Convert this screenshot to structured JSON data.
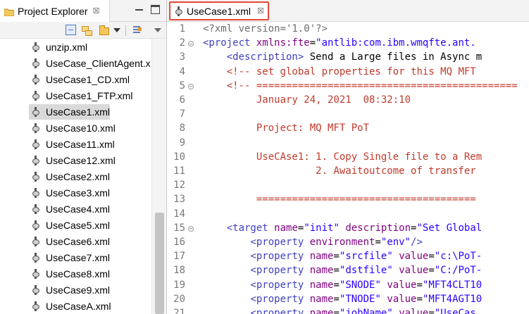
{
  "explorer": {
    "tab_label": "Project Explorer",
    "tab_close": "☒",
    "files": [
      "unzip.xml",
      "UseCase_ClientAgent.x",
      "UseCase1_CD.xml",
      "UseCase1_FTP.xml",
      "UseCase1.xml",
      "UseCase10.xml",
      "UseCase11.xml",
      "UseCase12.xml",
      "UseCase2.xml",
      "UseCase3.xml",
      "UseCase4.xml",
      "UseCase5.xml",
      "UseCase6.xml",
      "UseCase7.xml",
      "UseCase8.xml",
      "UseCase9.xml",
      "UseCaseA.xml"
    ],
    "selected_file": "UseCase1.xml"
  },
  "editor": {
    "tab_label": "UseCase1.xml",
    "tab_close": "☒",
    "lines": [
      {
        "n": "1",
        "fold": false,
        "segs": [
          [
            "decl",
            "<?xml version='1.0'?>"
          ]
        ]
      },
      {
        "n": "2",
        "fold": true,
        "segs": [
          [
            "tag",
            "<project "
          ],
          [
            "attr",
            "xmlns:fte"
          ],
          [
            "plain",
            "="
          ],
          [
            "val",
            "\"antlib:com.ibm.wmqfte.ant."
          ]
        ]
      },
      {
        "n": "3",
        "fold": false,
        "segs": [
          [
            "plain",
            "    "
          ],
          [
            "tag",
            "<description>"
          ],
          [
            "plain",
            " Send a Large files in Async m"
          ]
        ]
      },
      {
        "n": "4",
        "fold": false,
        "segs": [
          [
            "plain",
            "    "
          ],
          [
            "cmt",
            "<!-- set global properties for this MQ MFT"
          ]
        ]
      },
      {
        "n": "5",
        "fold": true,
        "segs": [
          [
            "plain",
            "    "
          ],
          [
            "cmt",
            "<!-- ============================================"
          ]
        ]
      },
      {
        "n": "6",
        "fold": false,
        "segs": [
          [
            "cmt",
            "         January 24, 2021  08:32:10"
          ]
        ]
      },
      {
        "n": "7",
        "fold": false,
        "segs": []
      },
      {
        "n": "8",
        "fold": false,
        "segs": [
          [
            "cmt",
            "         Project: MQ MFT PoT"
          ]
        ]
      },
      {
        "n": "9",
        "fold": false,
        "segs": []
      },
      {
        "n": "10",
        "fold": false,
        "segs": [
          [
            "cmt",
            "         UseCAse1: 1. Copy Single file to a Rem"
          ]
        ]
      },
      {
        "n": "11",
        "fold": false,
        "segs": [
          [
            "cmt",
            "                   2. Awaitoutcome of transfer"
          ]
        ]
      },
      {
        "n": "12",
        "fold": false,
        "segs": []
      },
      {
        "n": "13",
        "fold": false,
        "segs": [
          [
            "cmt",
            "         ====================================="
          ]
        ]
      },
      {
        "n": "14",
        "fold": false,
        "segs": []
      },
      {
        "n": "15",
        "fold": true,
        "segs": [
          [
            "plain",
            "    "
          ],
          [
            "tag",
            "<target "
          ],
          [
            "attr",
            "name"
          ],
          [
            "plain",
            "="
          ],
          [
            "val",
            "\"init\""
          ],
          [
            "plain",
            " "
          ],
          [
            "attr",
            "description"
          ],
          [
            "plain",
            "="
          ],
          [
            "val",
            "\"Set Global"
          ]
        ]
      },
      {
        "n": "16",
        "fold": false,
        "segs": [
          [
            "plain",
            "        "
          ],
          [
            "tag",
            "<property "
          ],
          [
            "attr",
            "environment"
          ],
          [
            "plain",
            "="
          ],
          [
            "val",
            "\"env\""
          ],
          [
            "tag",
            "/>"
          ]
        ]
      },
      {
        "n": "17",
        "fold": false,
        "segs": [
          [
            "plain",
            "        "
          ],
          [
            "tag",
            "<property "
          ],
          [
            "attr",
            "name"
          ],
          [
            "plain",
            "="
          ],
          [
            "val",
            "\"srcfile\""
          ],
          [
            "plain",
            " "
          ],
          [
            "attr",
            "value"
          ],
          [
            "plain",
            "="
          ],
          [
            "val",
            "\"c:\\PoT-"
          ]
        ]
      },
      {
        "n": "18",
        "fold": false,
        "segs": [
          [
            "plain",
            "        "
          ],
          [
            "tag",
            "<property "
          ],
          [
            "attr",
            "name"
          ],
          [
            "plain",
            "="
          ],
          [
            "val",
            "\"dstfile\""
          ],
          [
            "plain",
            " "
          ],
          [
            "attr",
            "value"
          ],
          [
            "plain",
            "="
          ],
          [
            "val",
            "\"C:/PoT-"
          ]
        ]
      },
      {
        "n": "19",
        "fold": false,
        "segs": [
          [
            "plain",
            "        "
          ],
          [
            "tag",
            "<property "
          ],
          [
            "attr",
            "name"
          ],
          [
            "plain",
            "="
          ],
          [
            "val",
            "\"SNODE\""
          ],
          [
            "plain",
            " "
          ],
          [
            "attr",
            "value"
          ],
          [
            "plain",
            "="
          ],
          [
            "val",
            "\"MFT4CLT10"
          ]
        ]
      },
      {
        "n": "20",
        "fold": false,
        "segs": [
          [
            "plain",
            "        "
          ],
          [
            "tag",
            "<property "
          ],
          [
            "attr",
            "name"
          ],
          [
            "plain",
            "="
          ],
          [
            "val",
            "\"TNODE\""
          ],
          [
            "plain",
            " "
          ],
          [
            "attr",
            "value"
          ],
          [
            "plain",
            "="
          ],
          [
            "val",
            "\"MFT4AGT10"
          ]
        ]
      },
      {
        "n": "21",
        "fold": false,
        "segs": [
          [
            "plain",
            "        "
          ],
          [
            "tag",
            "<property "
          ],
          [
            "attr",
            "name"
          ],
          [
            "plain",
            "="
          ],
          [
            "val",
            "\"jobName\""
          ],
          [
            "plain",
            " "
          ],
          [
            "attr",
            "value"
          ],
          [
            "plain",
            "="
          ],
          [
            "val",
            "\"UseCas"
          ]
        ]
      }
    ]
  },
  "colors": {
    "tab_highlight": "#e8483b",
    "selection": "#d9d9d9",
    "xml_tag": "#3f3fbf",
    "xml_attr": "#7f007f",
    "xml_value": "#2a00ff",
    "xml_comment": "#c0392b"
  }
}
